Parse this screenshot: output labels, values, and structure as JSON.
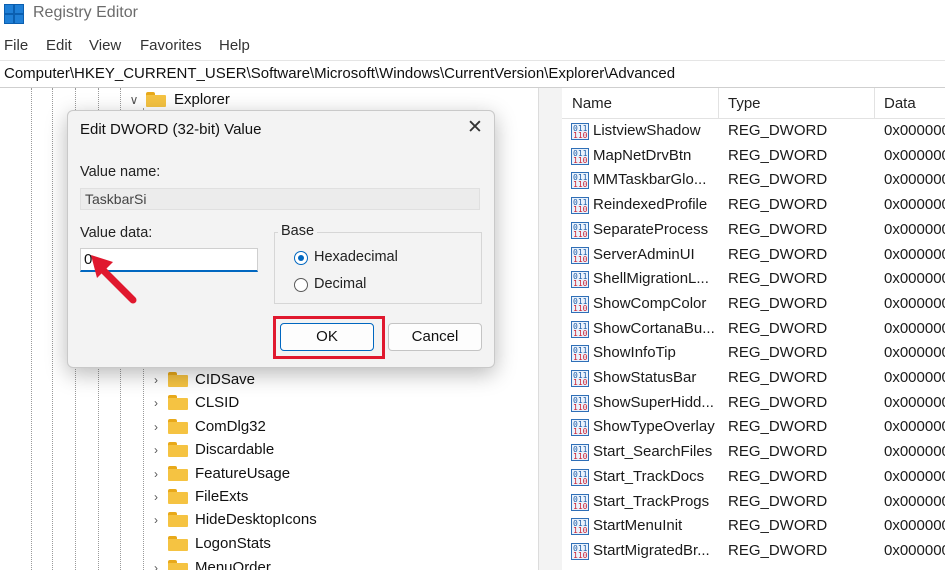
{
  "window": {
    "title": "Registry Editor"
  },
  "menu": [
    "File",
    "Edit",
    "View",
    "Favorites",
    "Help"
  ],
  "address": "Computer\\HKEY_CURRENT_USER\\Software\\Microsoft\\Windows\\CurrentVersion\\Explorer\\Advanced",
  "tree": {
    "parent": "Explorer",
    "items": [
      "CIDSave",
      "CLSID",
      "ComDlg32",
      "Discardable",
      "FeatureUsage",
      "FileExts",
      "HideDesktopIcons",
      "LogonStats",
      "MenuOrder"
    ]
  },
  "list": {
    "headers": {
      "name": "Name",
      "type": "Type",
      "data": "Data"
    },
    "rows": [
      {
        "name": "ListviewShadow",
        "type": "REG_DWORD",
        "data": "0x000000"
      },
      {
        "name": "MapNetDrvBtn",
        "type": "REG_DWORD",
        "data": "0x000000"
      },
      {
        "name": "MMTaskbarGlo...",
        "type": "REG_DWORD",
        "data": "0x000000"
      },
      {
        "name": "ReindexedProfile",
        "type": "REG_DWORD",
        "data": "0x000000"
      },
      {
        "name": "SeparateProcess",
        "type": "REG_DWORD",
        "data": "0x000000"
      },
      {
        "name": "ServerAdminUI",
        "type": "REG_DWORD",
        "data": "0x000000"
      },
      {
        "name": "ShellMigrationL...",
        "type": "REG_DWORD",
        "data": "0x000000"
      },
      {
        "name": "ShowCompColor",
        "type": "REG_DWORD",
        "data": "0x000000"
      },
      {
        "name": "ShowCortanaBu...",
        "type": "REG_DWORD",
        "data": "0x000000"
      },
      {
        "name": "ShowInfoTip",
        "type": "REG_DWORD",
        "data": "0x000000"
      },
      {
        "name": "ShowStatusBar",
        "type": "REG_DWORD",
        "data": "0x000000"
      },
      {
        "name": "ShowSuperHidd...",
        "type": "REG_DWORD",
        "data": "0x000000"
      },
      {
        "name": "ShowTypeOverlay",
        "type": "REG_DWORD",
        "data": "0x000000"
      },
      {
        "name": "Start_SearchFiles",
        "type": "REG_DWORD",
        "data": "0x000000"
      },
      {
        "name": "Start_TrackDocs",
        "type": "REG_DWORD",
        "data": "0x000000"
      },
      {
        "name": "Start_TrackProgs",
        "type": "REG_DWORD",
        "data": "0x000000"
      },
      {
        "name": "StartMenuInit",
        "type": "REG_DWORD",
        "data": "0x000000"
      },
      {
        "name": "StartMigratedBr...",
        "type": "REG_DWORD",
        "data": "0x000000"
      }
    ]
  },
  "dialog": {
    "title": "Edit DWORD (32-bit) Value",
    "value_name_label": "Value name:",
    "value_name": "TaskbarSi",
    "value_data_label": "Value data:",
    "value_data": "0",
    "base_label": "Base",
    "hex_label": "Hexadecimal",
    "dec_label": "Decimal",
    "base_selected": "Hexadecimal",
    "ok_label": "OK",
    "cancel_label": "Cancel"
  },
  "colors": {
    "highlight": "#e0182e",
    "accent": "#0067c0",
    "folder": "#f5c342"
  }
}
